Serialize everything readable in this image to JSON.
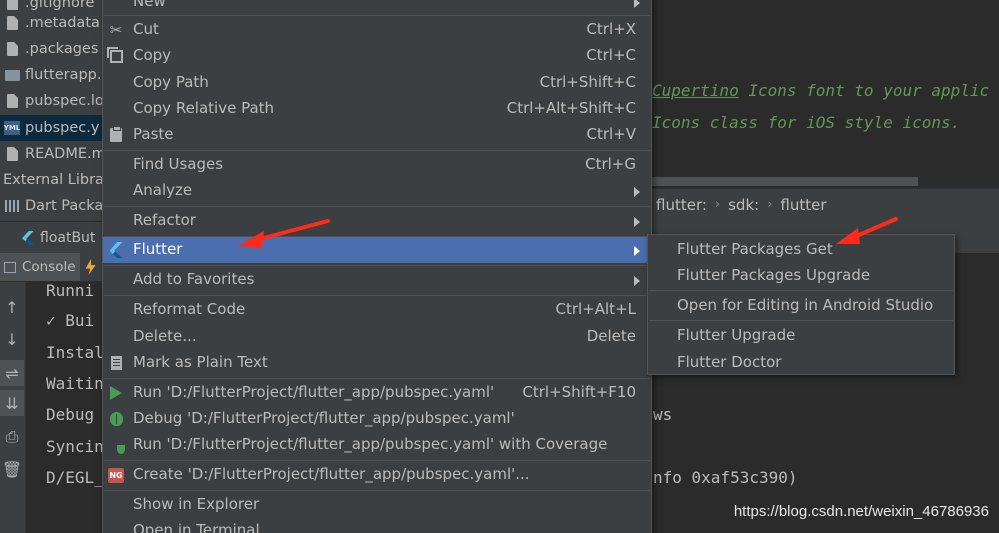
{
  "project_tree": [
    {
      "label": ".gitignore",
      "icon": "file-icon"
    },
    {
      "label": ".metadata",
      "icon": "file-icon"
    },
    {
      "label": ".packages",
      "icon": "file-icon"
    },
    {
      "label": "flutterapp.",
      "icon": "module-icon"
    },
    {
      "label": "pubspec.lo",
      "icon": "file-icon"
    },
    {
      "label": "pubspec.y",
      "icon": "yaml-file-icon",
      "selected": true
    },
    {
      "label": "README.m",
      "icon": "file-icon"
    },
    {
      "label": "External Libra",
      "icon": "libraries-icon"
    },
    {
      "label": "Dart Packa",
      "icon": "library-folder-icon"
    }
  ],
  "editor": {
    "comment_line_1_link": "Cupertino",
    "comment_line_1_rest": " Icons font to your applic",
    "comment_line_2": "Icons class for iOS style icons."
  },
  "breadcrumb": [
    "flutter:",
    "sdk:",
    "flutter"
  ],
  "editor_tab": {
    "label": "floatBut"
  },
  "console": {
    "tab_label": "Console",
    "lines": [
      "Runni",
      "✓ Bui",
      "Instal",
      "Waitin",
      "Debug",
      "Syncin",
      "D/EGL_"
    ],
    "line_tail_1": "ws",
    "line_tail_2": "nfo 0xaf53c390)"
  },
  "context_menu": {
    "items": [
      {
        "label": "New",
        "shortcut": "",
        "submenu": true
      },
      {
        "label": "Cut",
        "shortcut": "Ctrl+X",
        "icon": "scissors-icon"
      },
      {
        "label": "Copy",
        "shortcut": "Ctrl+C",
        "icon": "copy-icon"
      },
      {
        "label": "Copy Path",
        "shortcut": "Ctrl+Shift+C"
      },
      {
        "label": "Copy Relative Path",
        "shortcut": "Ctrl+Alt+Shift+C"
      },
      {
        "label": "Paste",
        "shortcut": "Ctrl+V",
        "icon": "paste-icon"
      },
      {
        "label": "Find Usages",
        "shortcut": "Ctrl+G"
      },
      {
        "label": "Analyze",
        "shortcut": "",
        "submenu": true
      },
      {
        "label": "Refactor",
        "shortcut": "",
        "submenu": true
      },
      {
        "label": "Flutter",
        "shortcut": "",
        "submenu": true,
        "highlighted": true,
        "icon": "flutter-icon"
      },
      {
        "label": "Add to Favorites",
        "shortcut": "",
        "submenu": true
      },
      {
        "label": "Reformat Code",
        "shortcut": "Ctrl+Alt+L"
      },
      {
        "label": "Delete...",
        "shortcut": "Delete"
      },
      {
        "label": "Mark as Plain Text",
        "shortcut": "",
        "icon": "plain-text-icon"
      },
      {
        "label": "Run 'D:/FlutterProject/flutter_app/pubspec.yaml'",
        "shortcut": "Ctrl+Shift+F10",
        "icon": "run-icon"
      },
      {
        "label": "Debug 'D:/FlutterProject/flutter_app/pubspec.yaml'",
        "shortcut": "",
        "icon": "debug-icon"
      },
      {
        "label": "Run 'D:/FlutterProject/flutter_app/pubspec.yaml' with Coverage",
        "shortcut": "",
        "icon": "coverage-icon"
      },
      {
        "label": "Create 'D:/FlutterProject/flutter_app/pubspec.yaml'...",
        "shortcut": "",
        "icon": "ng-icon"
      },
      {
        "label": "Show in Explorer",
        "shortcut": ""
      },
      {
        "label": "Open in Terminal",
        "shortcut": ""
      }
    ]
  },
  "flutter_submenu": {
    "items": [
      "Flutter Packages Get",
      "Flutter Packages Upgrade",
      "Open for Editing in Android Studio",
      "Flutter Upgrade",
      "Flutter Doctor"
    ]
  },
  "annotation_color": "#ff2a1a",
  "selection_color": "#4b6eaf",
  "watermark": "https://blog.csdn.net/weixin_46786936"
}
